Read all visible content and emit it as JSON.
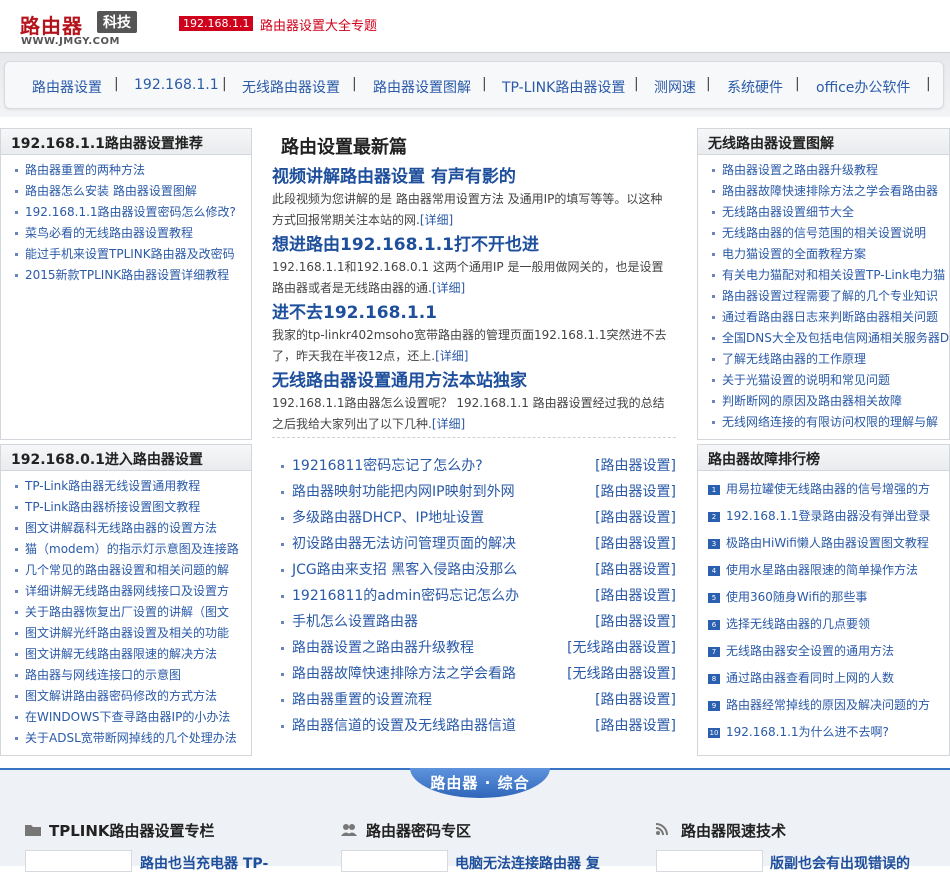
{
  "header": {
    "logo_text": "路由器",
    "logo_tag": "科技",
    "logo_url": "WWW.JMGY.COM",
    "ip_badge": "192.168.1.1",
    "link_1": "路由器设置大全",
    "link_2": "专题"
  },
  "nav": {
    "items": [
      "路由器设置",
      "192.168.1.1",
      "无线路由器设置",
      "路由器设置图解",
      "TP-LINK路由器设置",
      "测网速",
      "系统硬件",
      "office办公软件"
    ],
    "separator": "|"
  },
  "left_top": {
    "title": "192.168.1.1路由器设置推荐",
    "items": [
      "路由器重置的两种方法",
      "路由器怎么安装 路由器设置图解",
      "192.168.1.1路由器设置密码怎么修改?",
      "菜鸟必看的无线路由器设置教程",
      "能过手机来设置TPLINK路由器及改密码",
      "2015新款TPLINK路由器设置详细教程"
    ]
  },
  "left_bottom": {
    "title": "192.168.0.1进入路由器设置",
    "items": [
      "TP-Link路由器无线设置通用教程",
      "TP-Link路由器桥接设置图文教程",
      "图文讲解磊科无线路由器的设置方法",
      "猫（modem）的指示灯示意图及连接路",
      "几个常见的路由器设置和相关问题的解",
      "详细讲解无线路由器网线接口及设置方",
      "关于路由器恢复出厂设置的讲解（图文",
      "图文讲解光纤路由器设置及相关的功能",
      "图文讲解无线路由器限速的解决方法",
      "路由器与网线连接口的示意图",
      "图文解讲路由器密码修改的方式方法",
      "在WINDOWS下查寻路由器IP的小办法",
      "关于ADSL宽带断网掉线的几个处理办法"
    ]
  },
  "center": {
    "title": "路由设置最新篇",
    "articles": [
      {
        "title": "视频讲解路由器设置 有声有影的",
        "summary": "此段视频为您讲解的是 路由器常用设置方法 及通用IP的填写等等。以这种方式回报常期关注本站的网.",
        "more": "[详细]"
      },
      {
        "title": "想进路由192.168.1.1打不开也进",
        "summary": "192.168.1.1和192.168.0.1 这两个通用IP 是一般用做网关的，也是设置路由器或者是无线路由器的通.",
        "more": "[详细]"
      },
      {
        "title": "进不去192.168.1.1",
        "summary": "我家的tp-linkr402msoho宽带路由器的管理页面192.168.1.1突然进不去了，昨天我在半夜12点，还上.",
        "more": "[详细]"
      },
      {
        "title": "无线路由器设置通用方法本站独家",
        "summary": "192.168.1.1路由器怎么设置呢？ 192.168.1.1 路由器设置经过我的总结之后我给大家列出了以下几种.",
        "more": "[详细]"
      }
    ],
    "news": [
      {
        "title": "19216811密码忘记了怎么办?",
        "cat": "[路由器设置]"
      },
      {
        "title": "路由器映射功能把内网IP映射到外网",
        "cat": "[路由器设置]"
      },
      {
        "title": "多级路由器DHCP、IP地址设置",
        "cat": "[路由器设置]"
      },
      {
        "title": "初设路由器无法访问管理页面的解决",
        "cat": "[路由器设置]"
      },
      {
        "title": "JCG路由来支招 黑客入侵路由没那么",
        "cat": "[路由器设置]"
      },
      {
        "title": "19216811的admin密码忘记怎么办",
        "cat": "[路由器设置]"
      },
      {
        "title": "手机怎么设置路由器",
        "cat": "[路由器设置]"
      },
      {
        "title": "路由器设置之路由器升级教程",
        "cat": "[无线路由器设置]"
      },
      {
        "title": "路由器故障快速排除方法之学会看路",
        "cat": "[无线路由器设置]"
      },
      {
        "title": "路由器重置的设置流程",
        "cat": "[路由器设置]"
      },
      {
        "title": "路由器信道的设置及无线路由器信道",
        "cat": "[路由器设置]"
      }
    ]
  },
  "right_top": {
    "title": "无线路由器设置图解",
    "items": [
      "路由器设置之路由器升级教程",
      "路由器故障快速排除方法之学会看路由器",
      "无线路由器设置细节大全",
      "无线路由器的信号范围的相关设置说明",
      "电力猫设置的全面教程方案",
      "有关电力猫配对和相关设置TP-Link电力猫",
      "路由器设置过程需要了解的几个专业知识",
      "通过看路由器日志来判断路由器相关问题",
      "全国DNS大全及包括电信网通相关服务器D",
      "了解无线路由器的工作原理",
      "关于光猫设置的说明和常见问题",
      "判断断网的原因及路由器相关故障",
      "无线网络连接的有限访问权限的理解与解"
    ]
  },
  "right_bottom": {
    "title": "路由器故障排行榜",
    "items": [
      {
        "num": "1",
        "text": "用易拉罐使无线路由器的信号增强的方"
      },
      {
        "num": "2",
        "text": "192.168.1.1登录路由器没有弹出登录"
      },
      {
        "num": "3",
        "text": "极路由HiWifi懒人路由器设置图文教程"
      },
      {
        "num": "4",
        "text": "使用水星路由器限速的简单操作方法"
      },
      {
        "num": "5",
        "text": "使用360随身Wifi的那些事"
      },
      {
        "num": "6",
        "text": "选择无线路由器的几点要领"
      },
      {
        "num": "7",
        "text": "无线路由器安全设置的通用方法"
      },
      {
        "num": "8",
        "text": "通过路由器查看同时上网的人数"
      },
      {
        "num": "9",
        "text": "路由器经常掉线的原因及解决问题的方"
      },
      {
        "num": "10",
        "text": "192.168.1.1为什么进不去啊?"
      }
    ]
  },
  "bottom": {
    "title": "路由器 · 综合",
    "columns": [
      {
        "head": "TPLINK路由器设置专栏",
        "link": "路由也当充电器 TP-",
        "icon": "folder-icon"
      },
      {
        "head": "路由器密码专区",
        "link": "电脑无法连接路由器 复",
        "icon": "users-icon"
      },
      {
        "head": "路由器限速技术",
        "link": "版副也会有出现错误的",
        "icon": "rss-icon"
      }
    ]
  },
  "colors": {
    "accent": "#d0021b",
    "link": "#2a5aa8",
    "title_link": "#1e4f9c",
    "band": "#2f66b9"
  }
}
